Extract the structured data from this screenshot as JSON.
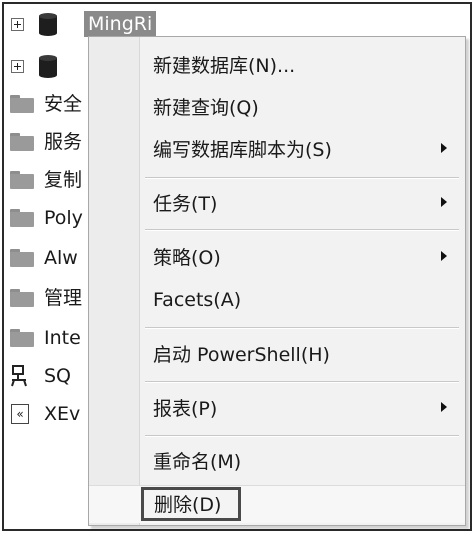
{
  "tree": {
    "nodes": [
      {
        "label": "MingRi",
        "type": "database",
        "expander": true,
        "selected": true
      },
      {
        "label": "",
        "type": "database",
        "expander": true
      },
      {
        "label": "安全",
        "type": "folder"
      },
      {
        "label": "服务",
        "type": "folder"
      },
      {
        "label": "复制",
        "type": "folder"
      },
      {
        "label": "Poly",
        "type": "folder"
      },
      {
        "label": "Alw",
        "type": "folder"
      },
      {
        "label": "管理",
        "type": "folder"
      },
      {
        "label": "Inte",
        "type": "folder"
      },
      {
        "label": "SQ",
        "type": "sql-agent"
      },
      {
        "label": "XEv",
        "type": "xevent"
      }
    ]
  },
  "context_menu": {
    "items": [
      {
        "label": "新建数据库(N)...",
        "submenu": false
      },
      {
        "label": "新建查询(Q)",
        "submenu": false
      },
      {
        "label": "编写数据库脚本为(S)",
        "submenu": true
      },
      {
        "label": "任务(T)",
        "submenu": true
      },
      {
        "label": "策略(O)",
        "submenu": true
      },
      {
        "label": "Facets(A)",
        "submenu": false
      },
      {
        "label": "启动 PowerShell(H)",
        "submenu": false
      },
      {
        "label": "报表(P)",
        "submenu": true
      },
      {
        "label": "重命名(M)",
        "submenu": false
      },
      {
        "label": "删除(D)",
        "submenu": false,
        "highlighted": true
      }
    ]
  }
}
